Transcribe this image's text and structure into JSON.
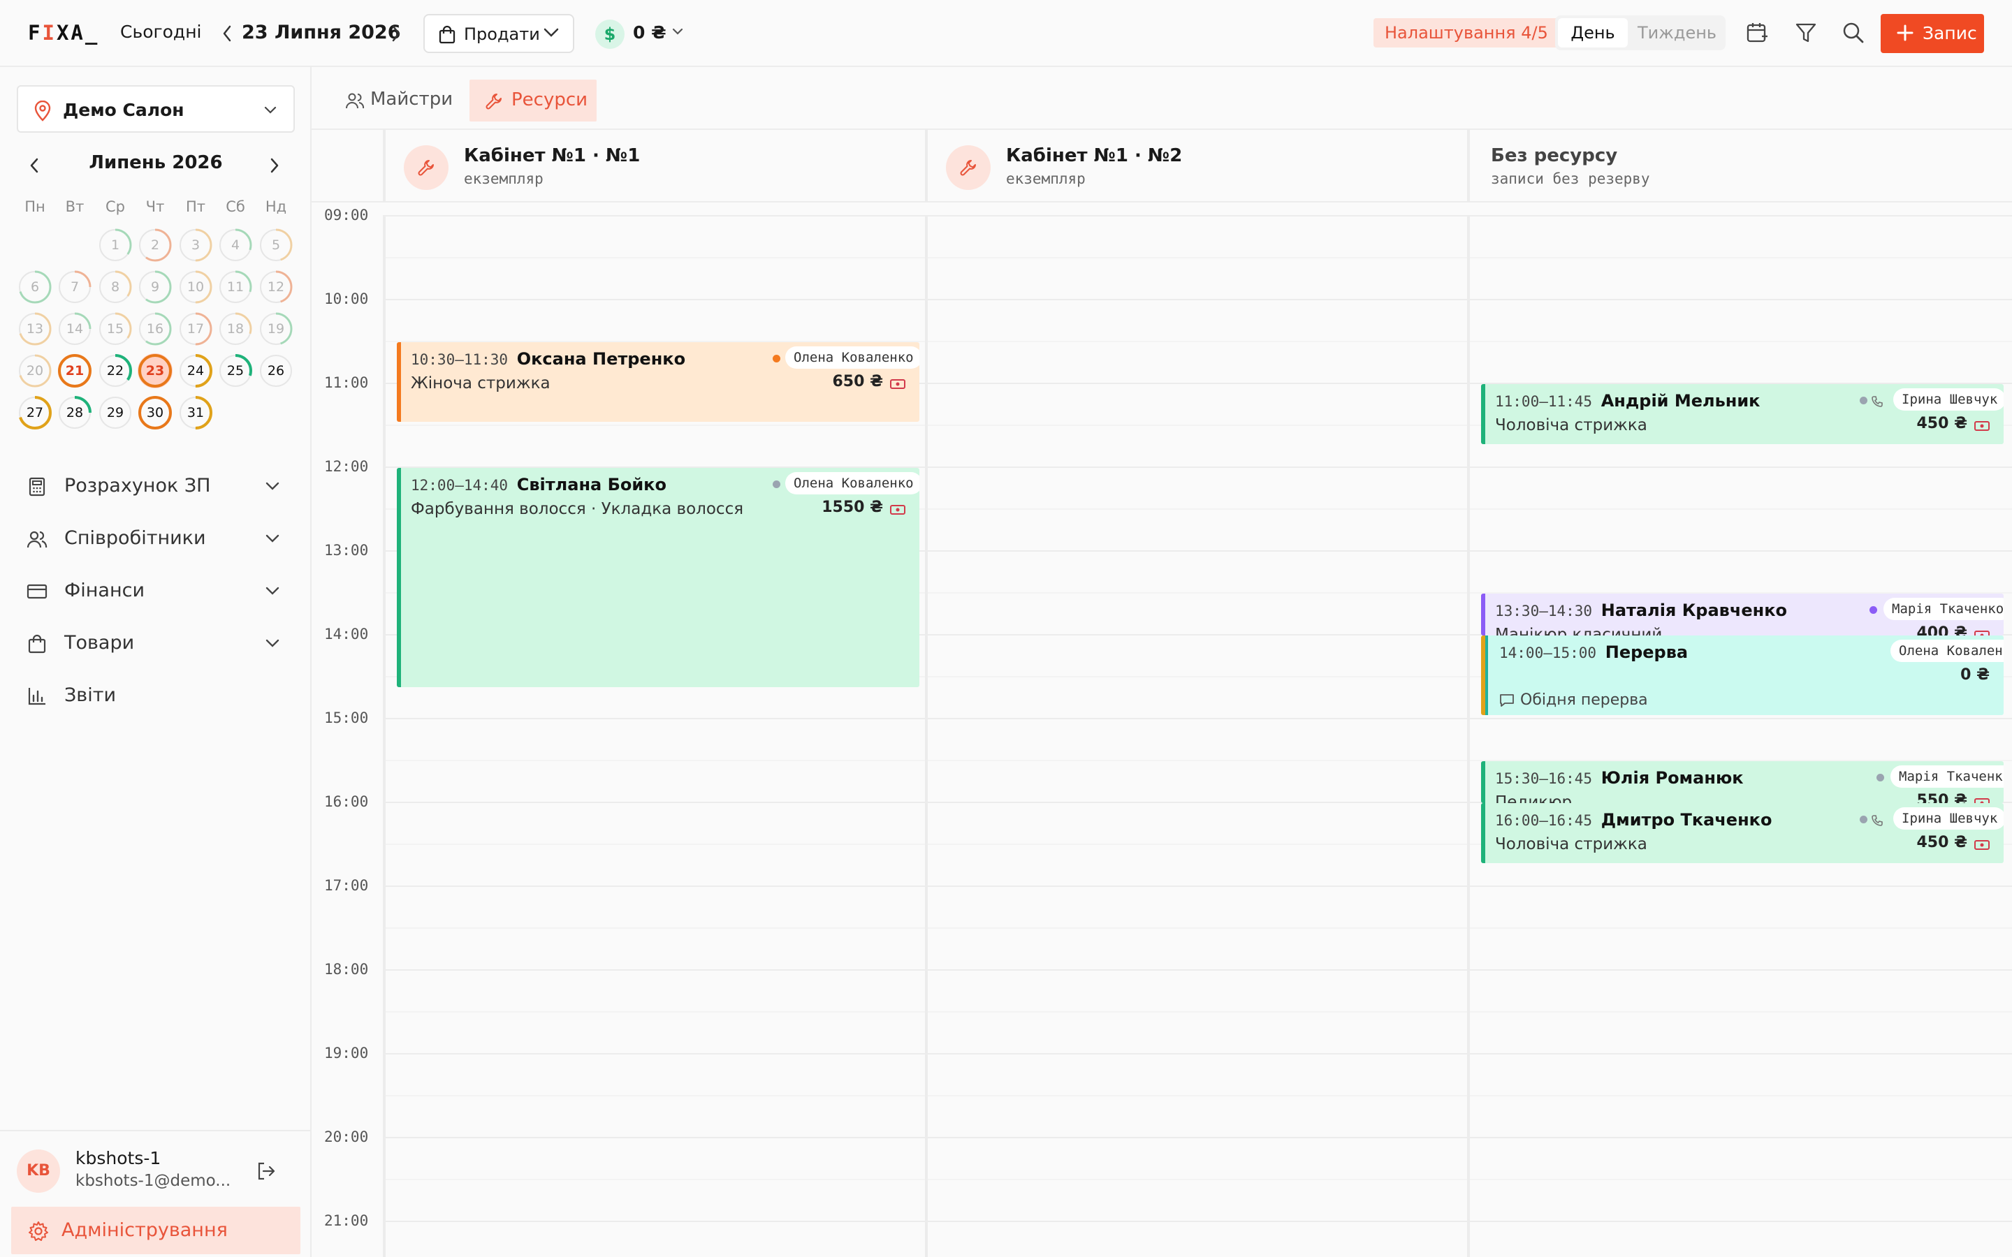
{
  "topbar": {
    "logo": {
      "prefix": "F",
      "accent": "I",
      "suffix": "XA_"
    },
    "today_label": "Сьогодні",
    "current_date": "23 Липня 2026",
    "sell_label": "Продати",
    "cash_symbol": "$",
    "cash_value": "0 ₴",
    "setup_badge": "Налаштування 4/5",
    "view_day": "День",
    "view_week": "Тиждень",
    "new_label": "Запис"
  },
  "sidebar": {
    "salon": "Демо Салон",
    "calendar": {
      "title": "Липень 2026",
      "weekdays": [
        "Пн",
        "Вт",
        "Ср",
        "Чт",
        "Пт",
        "Сб",
        "Нд"
      ],
      "today": 21,
      "selected": 23
    },
    "menu": [
      {
        "label": "Розрахунок ЗП",
        "icon": "calculator-icon"
      },
      {
        "label": "Співробітники",
        "icon": "users-icon"
      },
      {
        "label": "Фінанси",
        "icon": "credit-card-icon"
      },
      {
        "label": "Товари",
        "icon": "shopping-bag-icon"
      },
      {
        "label": "Звіти",
        "icon": "bar-chart-icon"
      }
    ],
    "user": {
      "initials": "KB",
      "name": "kbshots-1",
      "email": "kbshots-1@demo..."
    },
    "admin_label": "Адміністрування"
  },
  "tabs": {
    "masters": "Майстри",
    "resources": "Ресурси"
  },
  "columns": [
    {
      "name": "Кабінет №1 · №1",
      "sub": "екземпляр"
    },
    {
      "name": "Кабінет №1 · №2",
      "sub": "екземпляр"
    },
    {
      "name": "Без ресурсу",
      "sub": "записи без резерву"
    }
  ],
  "hours": [
    "09:00",
    "10:00",
    "11:00",
    "12:00",
    "13:00",
    "14:00",
    "15:00",
    "16:00",
    "17:00",
    "18:00",
    "19:00",
    "20:00",
    "21:00"
  ],
  "appointments": [
    {
      "time": "10:30–11:30",
      "client": "Оксана Петренко",
      "service": "Жіноча стрижка",
      "staff": "Олена Коваленко",
      "price": "650 ₴"
    },
    {
      "time": "12:00–14:40",
      "client": "Світлана Бойко",
      "service": "Фарбування волосся · Укладка волосся",
      "staff": "Олена Коваленко",
      "price": "1550 ₴"
    },
    {
      "time": "11:00–11:45",
      "client": "Андрій Мельник",
      "service": "Чоловіча стрижка",
      "staff": "Ірина Шевчук",
      "price": "450 ₴"
    },
    {
      "time": "13:30–14:30",
      "client": "Наталія Кравченко",
      "service": "Манікюр класичний",
      "staff": "Марія Ткаченко",
      "price": "400 ₴"
    },
    {
      "time": "14:00–15:00",
      "client": "Перерва",
      "service": "",
      "staff": "Олена Коваленко",
      "price": "0 ₴",
      "note": "Обідня перерва"
    },
    {
      "time": "15:30–16:45",
      "client": "Юлія Романюк",
      "service": "Педикюр",
      "staff": "Марія Ткаченко",
      "price": "550 ₴"
    },
    {
      "time": "16:00–16:45",
      "client": "Дмитро Ткаченко",
      "service": "Чоловіча стрижка",
      "staff": "Ірина Шевчук",
      "price": "450 ₴"
    }
  ],
  "colors": {
    "accent": "#f04a23",
    "accent_soft": "#fde3dc",
    "status_orange": "#f47a1f",
    "status_green": "#1fb27a",
    "status_purple": "#8b5cf6",
    "break_bar": "#e0a21a",
    "card_orange": "#ffe9d2",
    "card_green": "#d0f7e2",
    "card_purple": "#ede7fd",
    "card_teal": "#cbfaf0"
  }
}
